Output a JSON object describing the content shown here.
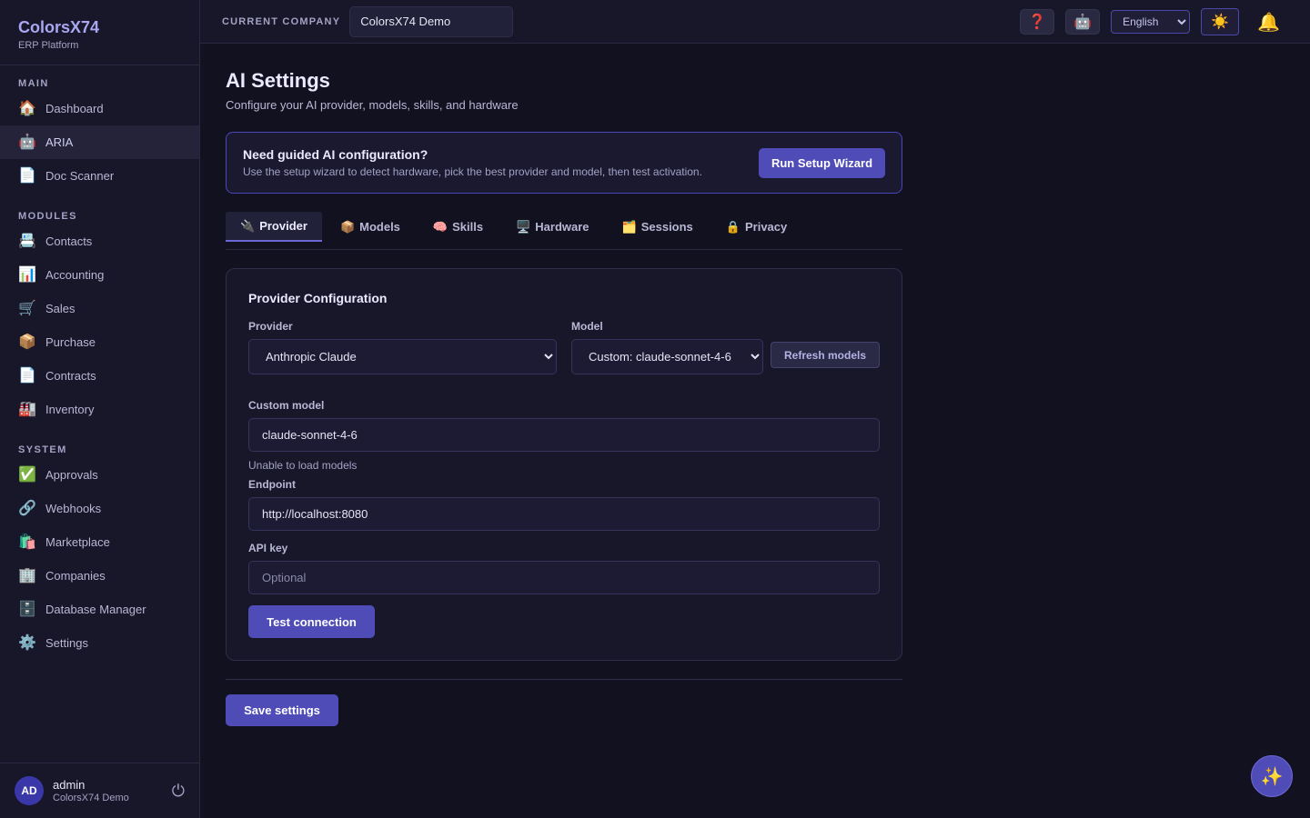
{
  "brand": {
    "title": "ColorsX74",
    "subtitle": "ERP Platform"
  },
  "sidebar": {
    "sections": [
      {
        "label": "MAIN",
        "items": [
          {
            "label": "Dashboard",
            "icon": "🏠",
            "icon_name": "home-icon"
          },
          {
            "label": "ARIA",
            "icon": "🤖",
            "icon_name": "robot-icon",
            "active": true
          },
          {
            "label": "Doc Scanner",
            "icon": "📄",
            "icon_name": "document-icon"
          }
        ]
      },
      {
        "label": "MODULES",
        "items": [
          {
            "label": "Contacts",
            "icon": "📇",
            "icon_name": "contact-card-icon"
          },
          {
            "label": "Accounting",
            "icon": "📊",
            "icon_name": "bar-chart-icon"
          },
          {
            "label": "Sales",
            "icon": "🛒",
            "icon_name": "cart-icon"
          },
          {
            "label": "Purchase",
            "icon": "📦",
            "icon_name": "package-icon"
          },
          {
            "label": "Contracts",
            "icon": "📄",
            "icon_name": "document-icon"
          },
          {
            "label": "Inventory",
            "icon": "🏭",
            "icon_name": "factory-icon"
          }
        ]
      },
      {
        "label": "SYSTEM",
        "items": [
          {
            "label": "Approvals",
            "icon": "✅",
            "icon_name": "check-icon"
          },
          {
            "label": "Webhooks",
            "icon": "🔗",
            "icon_name": "link-icon"
          },
          {
            "label": "Marketplace",
            "icon": "🛍️",
            "icon_name": "shopping-bags-icon"
          },
          {
            "label": "Companies",
            "icon": "🏢",
            "icon_name": "building-icon"
          },
          {
            "label": "Database Manager",
            "icon": "🗄️",
            "icon_name": "database-icon"
          },
          {
            "label": "Settings",
            "icon": "⚙️",
            "icon_name": "gear-icon"
          }
        ]
      }
    ]
  },
  "user": {
    "initials": "AD",
    "name": "admin",
    "company": "ColorsX74 Demo",
    "logout_icon": "⏻"
  },
  "topbar": {
    "company_label": "CURRENT COMPANY",
    "company_value": "ColorsX74 Demo",
    "help_icon": "❓",
    "assistant_icon": "🤖",
    "language": "English",
    "theme_icon": "☀️",
    "bell_icon": "🔔"
  },
  "page": {
    "title": "AI Settings",
    "subtitle": "Configure your AI provider, models, skills, and hardware"
  },
  "wizard": {
    "title": "Need guided AI configuration?",
    "description": "Use the setup wizard to detect hardware, pick the best provider and model, then test activation.",
    "button": "Run Setup Wizard"
  },
  "tabs": [
    {
      "label": "Provider",
      "icon": "🔌",
      "active": true
    },
    {
      "label": "Models",
      "icon": "📦"
    },
    {
      "label": "Skills",
      "icon": "🧠"
    },
    {
      "label": "Hardware",
      "icon": "🖥️"
    },
    {
      "label": "Sessions",
      "icon": "🗂️"
    },
    {
      "label": "Privacy",
      "icon": "🔒"
    }
  ],
  "provider_config": {
    "title": "Provider Configuration",
    "provider_label": "Provider",
    "provider_value": "Anthropic Claude",
    "model_label": "Model",
    "model_value": "Custom: claude-sonnet-4-6",
    "refresh_button": "Refresh models",
    "custom_model_label": "Custom model",
    "custom_model_value": "claude-sonnet-4-6",
    "models_hint": "Unable to load models",
    "endpoint_label": "Endpoint",
    "endpoint_value": "http://localhost:8080",
    "api_key_label": "API key",
    "api_key_placeholder": "Optional",
    "test_button": "Test connection"
  },
  "save_button": "Save settings",
  "fab_icon": "✨",
  "colors": {
    "accent": "#4f4cb8",
    "background": "#12111f",
    "sidebar": "#181729"
  }
}
